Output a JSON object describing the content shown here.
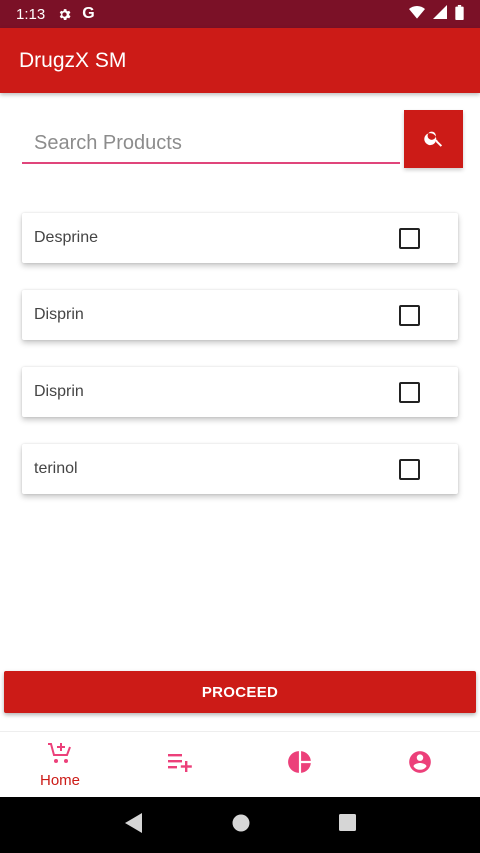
{
  "status_bar": {
    "time": "1:13",
    "icons": [
      "gear-icon",
      "google-g-icon",
      "wifi-icon",
      "signal-icon",
      "battery-icon"
    ]
  },
  "app_bar": {
    "title": "DrugzX SM"
  },
  "search": {
    "placeholder": "Search Products",
    "value": "",
    "button_icon": "search-icon"
  },
  "products": [
    {
      "name": "Desprine",
      "checked": false
    },
    {
      "name": "Disprin",
      "checked": false
    },
    {
      "name": "Disprin",
      "checked": false
    },
    {
      "name": "terinol",
      "checked": false
    }
  ],
  "proceed_label": "PROCEED",
  "bottom_nav": {
    "items": [
      {
        "label": "Home",
        "icon": "cart-add-icon",
        "active": true
      },
      {
        "label": "",
        "icon": "playlist-add-icon",
        "active": false
      },
      {
        "label": "",
        "icon": "pie-chart-icon",
        "active": false
      },
      {
        "label": "",
        "icon": "account-circle-icon",
        "active": false
      }
    ]
  },
  "colors": {
    "primary": "#cc1b17",
    "status_bar": "#7b1127",
    "accent": "#e0457b",
    "nav_icon": "#ec407a"
  }
}
